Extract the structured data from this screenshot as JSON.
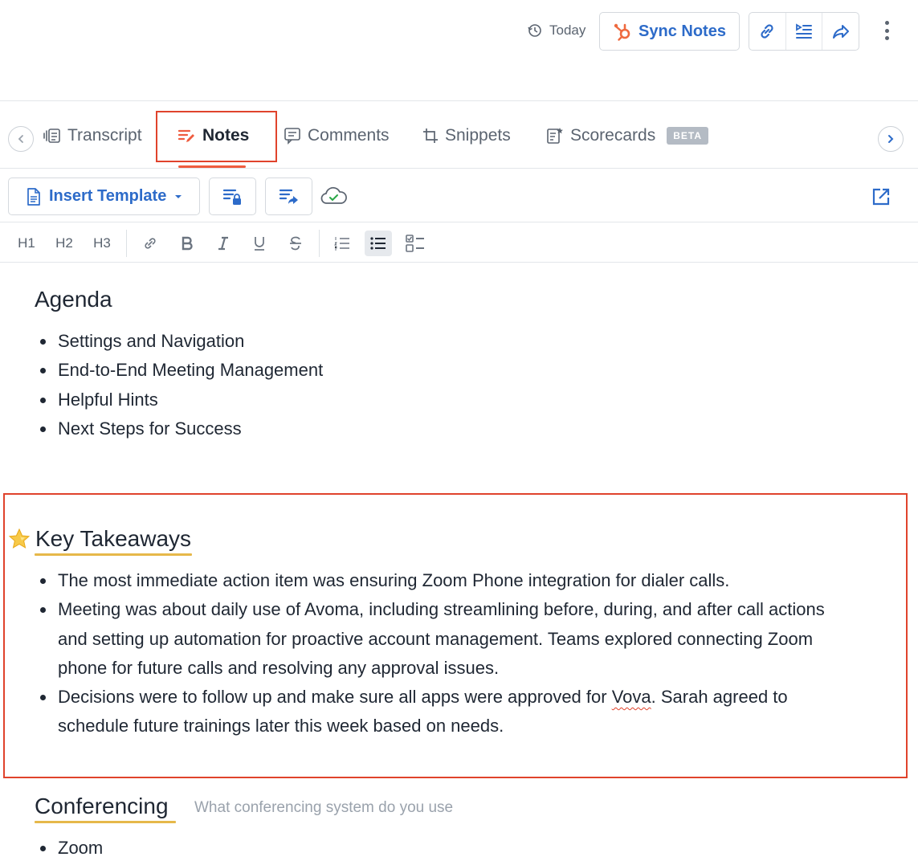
{
  "header": {
    "date_label": "Today",
    "sync_label": "Sync Notes",
    "icons": [
      "history-icon",
      "hubspot-icon",
      "link-icon",
      "outline-icon",
      "share-icon",
      "more-icon"
    ]
  },
  "tabs": {
    "items": [
      {
        "label": "Transcript",
        "icon": "transcript-icon"
      },
      {
        "label": "Notes",
        "icon": "notes-icon",
        "active": true
      },
      {
        "label": "Comments",
        "icon": "comment-icon"
      },
      {
        "label": "Snippets",
        "icon": "crop-icon"
      },
      {
        "label": "Scorecards",
        "icon": "scorecard-icon",
        "badge": "BETA"
      }
    ]
  },
  "toolbar": {
    "insert_template_label": "Insert Template",
    "format": {
      "h1": "H1",
      "h2": "H2",
      "h3": "H3"
    }
  },
  "document": {
    "agenda": {
      "heading": "Agenda",
      "items": [
        "Settings and Navigation",
        "End-to-End Meeting Management",
        "Helpful Hints",
        "Next Steps for Success"
      ]
    },
    "takeaways": {
      "heading": "Key Takeaways",
      "items": [
        "The most immediate action item was ensuring Zoom Phone integration for dialer calls.",
        "Meeting was about daily use of Avoma, including streamlining before, during, and after call actions and setting up automation for proactive account management. Teams explored connecting Zoom phone for future calls and resolving any approval issues."
      ],
      "item3_before": "Decisions were to follow up and make sure all apps were approved for ",
      "item3_flagged": "Vova",
      "item3_after": ". Sarah agreed to schedule future trainings later this week based on needs."
    },
    "conferencing": {
      "heading": "Conferencing",
      "hint": "What conferencing system do you use",
      "items": [
        "Zoom"
      ]
    }
  },
  "colors": {
    "accent_blue": "#2d6bc9",
    "highlight_red": "#e0432c",
    "underline_gold": "#e6b84a",
    "hubspot_orange": "#ef6a3f"
  }
}
